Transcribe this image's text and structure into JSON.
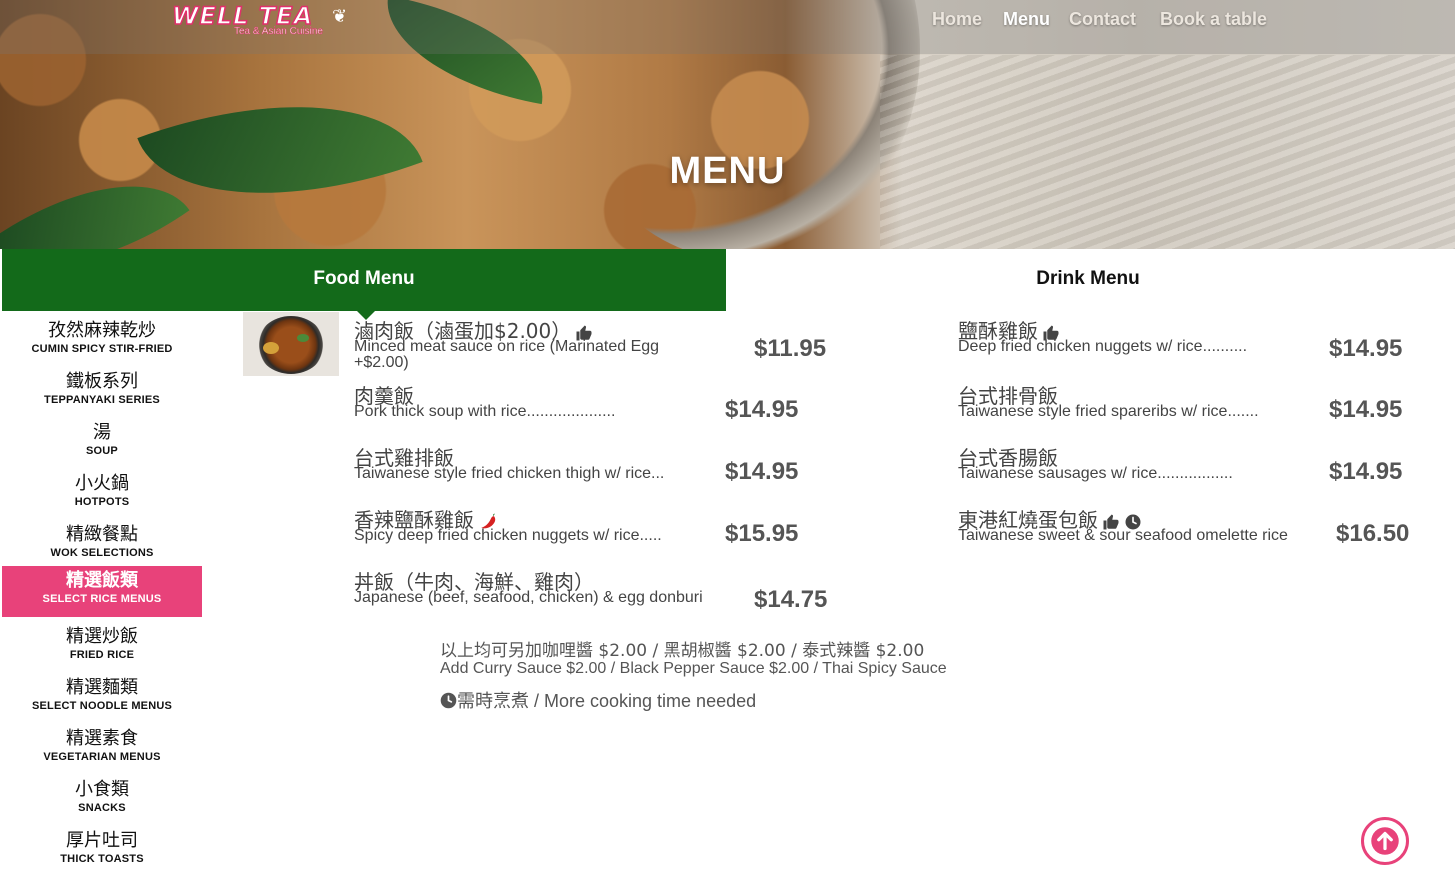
{
  "brand": {
    "logo_text": "WELL TEA",
    "logo_tagline": "Tea & Asian Cuisine"
  },
  "nav": {
    "items": [
      "Home",
      "Menu",
      "Contact",
      "Book a table"
    ],
    "active": "Menu"
  },
  "hero": {
    "title": "MENU"
  },
  "tabs": {
    "food": "Food Menu",
    "drink": "Drink Menu"
  },
  "sidebar": {
    "categories": [
      {
        "zh": "孜然麻辣乾炒",
        "en": "CUMIN SPICY STIR-FRIED"
      },
      {
        "zh": "鐵板系列",
        "en": "TEPPANYAKI SERIES"
      },
      {
        "zh": "湯",
        "en": "SOUP"
      },
      {
        "zh": "小火鍋",
        "en": "HOTPOTS"
      },
      {
        "zh": "精緻餐點",
        "en": "WOK SELECTIONS"
      },
      {
        "zh": "精選飯類",
        "en": "SELECT RICE MENUS"
      },
      {
        "zh": "精選炒飯",
        "en": "FRIED RICE"
      },
      {
        "zh": "精選麵類",
        "en": "SELECT NOODLE MENUS"
      },
      {
        "zh": "精選素食",
        "en": "VEGETARIAN MENUS"
      },
      {
        "zh": "小食類",
        "en": "SNACKS"
      },
      {
        "zh": "厚片吐司",
        "en": "THICK TOASTS"
      }
    ],
    "active_index": 5
  },
  "menu": {
    "left": [
      {
        "zh": "滷肉飯（滷蛋加$2.00）",
        "en": "Minced meat sauce on rice (Marinated Egg +$2.00)",
        "price": "$11.95",
        "icons": [
          "thumbs-up-icon"
        ]
      },
      {
        "zh": "肉羹飯",
        "en": "Pork thick soup with rice....................",
        "price": "$14.95",
        "icons": []
      },
      {
        "zh": "台式雞排飯",
        "en": "Taiwanese style fried chicken thigh w/ rice...",
        "price": "$14.95",
        "icons": []
      },
      {
        "zh": "香辣鹽酥雞飯",
        "en": "Spicy deep fried chicken nuggets w/ rice.....",
        "price": "$15.95",
        "icons": [
          "chili-pepper-icon"
        ]
      },
      {
        "zh": "丼飯（牛肉、海鮮、雞肉）",
        "en": "Japanese (beef, seafood, chicken) & egg donburi",
        "price": "$14.75",
        "icons": []
      }
    ],
    "right": [
      {
        "zh": "鹽酥雞飯",
        "en": "Deep fried chicken nuggets w/ rice..........",
        "price": "$14.95",
        "icons": [
          "thumbs-up-icon"
        ]
      },
      {
        "zh": "台式排骨飯",
        "en": "Taiwanese style fried spareribs w/ rice.......",
        "price": "$14.95",
        "icons": []
      },
      {
        "zh": "台式香腸飯",
        "en": "Taiwanese sausages w/ rice.................",
        "price": "$14.95",
        "icons": []
      },
      {
        "zh": "東港紅燒蛋包飯",
        "en": "Taiwanese sweet & sour seafood omelette rice",
        "price": "$16.50",
        "icons": [
          "thumbs-up-icon",
          "clock-icon"
        ]
      }
    ]
  },
  "notes": {
    "zh": "以上均可另加咖哩醬 $2.00 / 黑胡椒醬 $2.00 / 泰式辣醬 $2.00",
    "en": "Add Curry Sauce $2.00 / Black Pepper Sauce $2.00 / Thai Spicy Sauce",
    "time_note": "需時烹煮 / More cooking time needed"
  },
  "colors": {
    "food_tab": "#136a1a",
    "active_category": "#e8427a",
    "text": "#444444",
    "accent_pink": "#e8427a"
  }
}
